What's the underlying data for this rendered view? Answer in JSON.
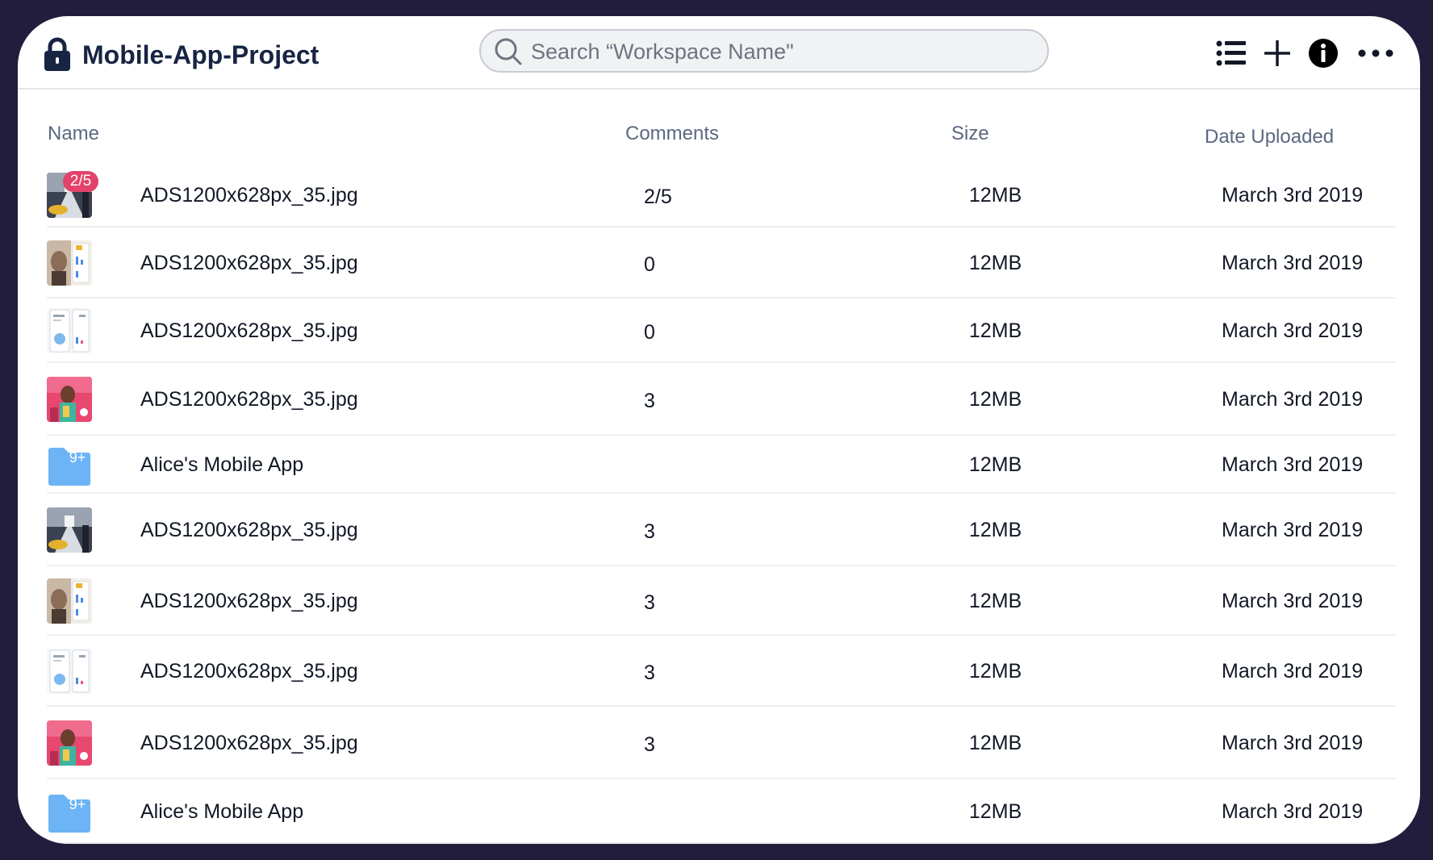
{
  "header": {
    "title": "Mobile-App-Project",
    "search_placeholder": "Search “Workspace Name\"",
    "toolbar_icons": [
      "list-icon",
      "plus-icon",
      "info-icon",
      "more-icon"
    ]
  },
  "table": {
    "columns": {
      "name": "Name",
      "comments": "Comments",
      "size": "Size",
      "date": "Date Uploaded"
    },
    "rows": [
      {
        "type": "image",
        "thumb": "car",
        "badge": "2/5",
        "name": "ADS1200x628px_35.jpg",
        "comments": "2/5",
        "size": "12MB",
        "date": "March 3rd 2019"
      },
      {
        "type": "image",
        "thumb": "portrait",
        "name": "ADS1200x628px_35.jpg",
        "comments": "0",
        "size": "12MB",
        "date": "March 3rd 2019"
      },
      {
        "type": "image",
        "thumb": "ui",
        "name": "ADS1200x628px_35.jpg",
        "comments": "0",
        "size": "12MB",
        "date": "March 3rd 2019"
      },
      {
        "type": "image",
        "thumb": "pink",
        "name": "ADS1200x628px_35.jpg",
        "comments": "3",
        "size": "12MB",
        "date": "March 3rd 2019"
      },
      {
        "type": "folder",
        "folder_badge": "9+",
        "name": "Alice's Mobile App",
        "comments": "",
        "size": "12MB",
        "date": "March 3rd 2019"
      },
      {
        "type": "image",
        "thumb": "car",
        "name": "ADS1200x628px_35.jpg",
        "comments": "3",
        "size": "12MB",
        "date": "March 3rd 2019"
      },
      {
        "type": "image",
        "thumb": "portrait",
        "name": "ADS1200x628px_35.jpg",
        "comments": "3",
        "size": "12MB",
        "date": "March 3rd 2019"
      },
      {
        "type": "image",
        "thumb": "ui",
        "name": "ADS1200x628px_35.jpg",
        "comments": "3",
        "size": "12MB",
        "date": "March 3rd 2019"
      },
      {
        "type": "image",
        "thumb": "pink",
        "name": "ADS1200x628px_35.jpg",
        "comments": "3",
        "size": "12MB",
        "date": "March 3rd 2019"
      },
      {
        "type": "folder",
        "folder_badge": "9+",
        "name": "Alice's Mobile App",
        "comments": "",
        "size": "12MB",
        "date": "March 3rd 2019"
      }
    ]
  },
  "colors": {
    "background": "#221c3d",
    "title": "#172442",
    "badge": "#e3426b",
    "folder": "#6cb4f5"
  }
}
